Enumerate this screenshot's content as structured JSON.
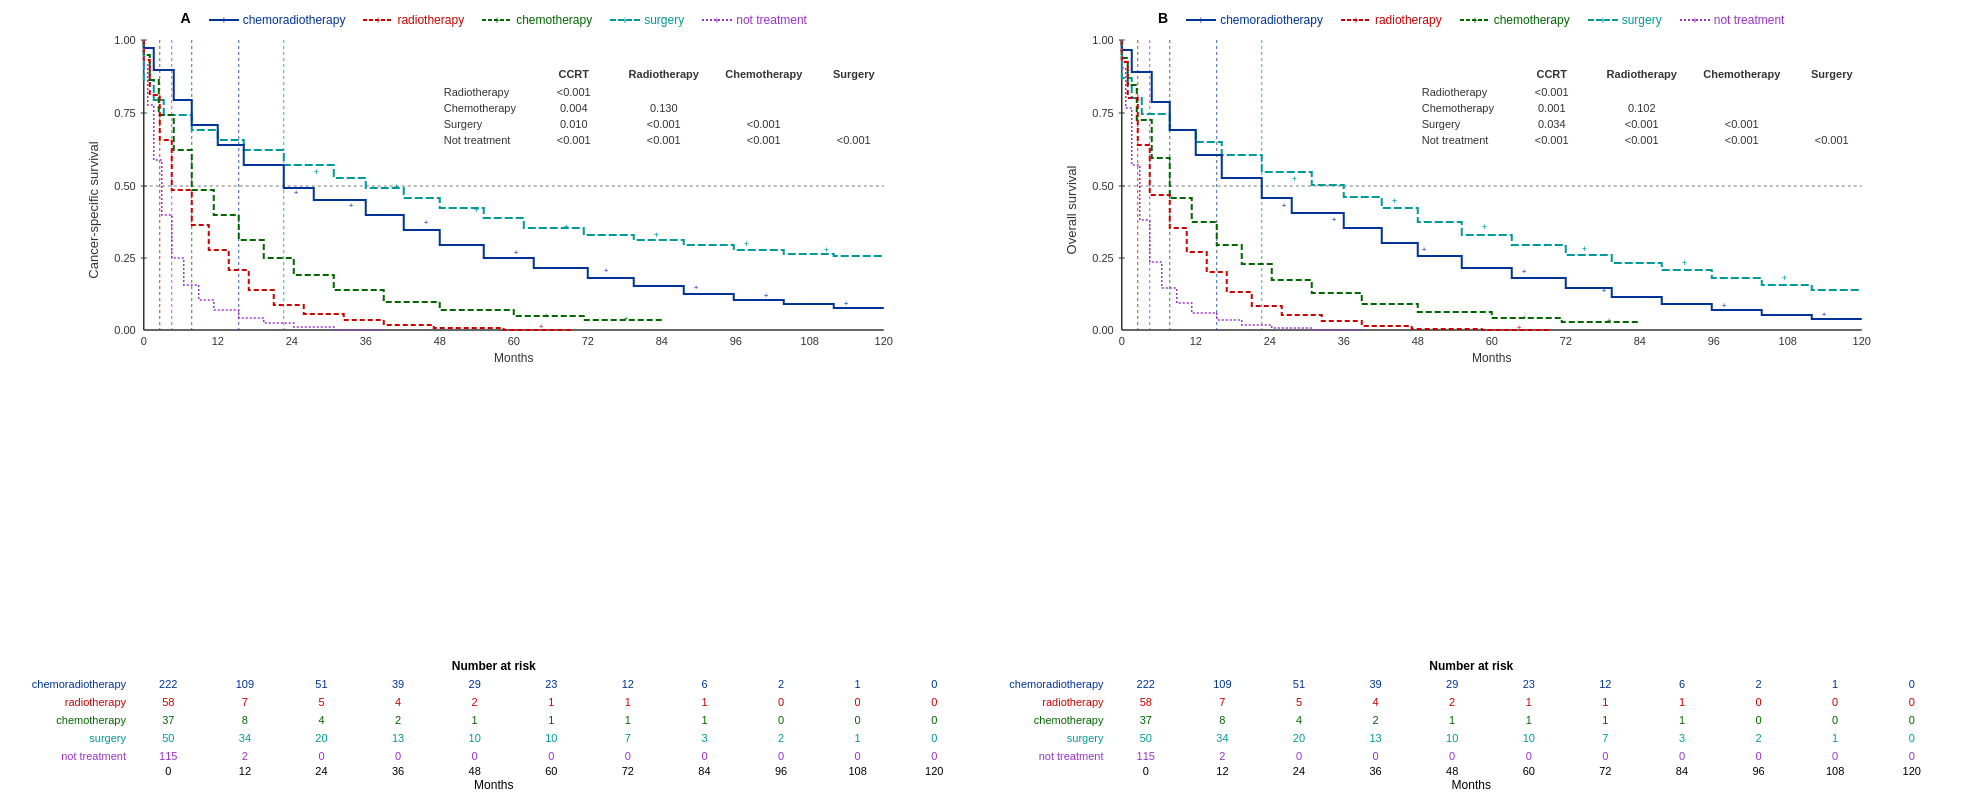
{
  "panels": [
    {
      "id": "A",
      "yLabel": "Cancer-specific survival",
      "legend": [
        {
          "label": "chemoradiotherapy",
          "color": "#003399",
          "dash": "solid",
          "marker": "+"
        },
        {
          "label": "radiotherapy",
          "color": "#cc0000",
          "dash": "dashed",
          "marker": "+"
        },
        {
          "label": "chemotherapy",
          "color": "#006600",
          "dash": "dashed",
          "marker": "+"
        },
        {
          "label": "surgery",
          "color": "#009999",
          "dash": "dashed",
          "marker": "+"
        },
        {
          "label": "not treatment",
          "color": "#9933cc",
          "dash": "dotted",
          "marker": "+"
        }
      ],
      "pvalueTable": {
        "headers": [
          "",
          "CCRT",
          "Radiotherapy",
          "Chemotherapy",
          "Surgery"
        ],
        "rows": [
          [
            "Radiotherapy",
            "<0.001",
            "",
            "",
            ""
          ],
          [
            "Chemotherapy",
            "0.004",
            "0.130",
            "",
            ""
          ],
          [
            "Surgery",
            "0.010",
            "<0.001",
            "<0.001",
            ""
          ],
          [
            "Not treatment",
            "<0.001",
            "<0.001",
            "<0.001",
            "<0.001"
          ]
        ]
      },
      "riskTable": {
        "title": "Number at risk",
        "rows": [
          {
            "label": "chemoradiotherapy",
            "color": "#003399",
            "values": [
              "222",
              "109",
              "51",
              "39",
              "29",
              "23",
              "12",
              "6",
              "2",
              "1",
              "0"
            ]
          },
          {
            "label": "radiotherapy",
            "color": "#cc0000",
            "values": [
              "58",
              "7",
              "5",
              "4",
              "2",
              "1",
              "1",
              "1",
              "0",
              "0",
              "0"
            ]
          },
          {
            "label": "chemotherapy",
            "color": "#006600",
            "values": [
              "37",
              "8",
              "4",
              "2",
              "1",
              "1",
              "1",
              "1",
              "0",
              "0",
              "0"
            ]
          },
          {
            "label": "surgery",
            "color": "#009999",
            "values": [
              "50",
              "34",
              "20",
              "13",
              "10",
              "10",
              "7",
              "3",
              "2",
              "1",
              "0"
            ]
          },
          {
            "label": "not treatment",
            "color": "#9933cc",
            "values": [
              "115",
              "2",
              "0",
              "0",
              "0",
              "0",
              "0",
              "0",
              "0",
              "0",
              "0"
            ]
          }
        ],
        "axisValues": [
          "0",
          "12",
          "24",
          "36",
          "48",
          "60",
          "72",
          "84",
          "96",
          "108",
          "120"
        ]
      }
    },
    {
      "id": "B",
      "yLabel": "Overall survival",
      "legend": [
        {
          "label": "chemoradiotherapy",
          "color": "#003399",
          "dash": "solid",
          "marker": "+"
        },
        {
          "label": "radiotherapy",
          "color": "#cc0000",
          "dash": "dashed",
          "marker": "+"
        },
        {
          "label": "chemotherapy",
          "color": "#006600",
          "dash": "dashed",
          "marker": "+"
        },
        {
          "label": "surgery",
          "color": "#009999",
          "dash": "dashed",
          "marker": "+"
        },
        {
          "label": "not treatment",
          "color": "#9933cc",
          "dash": "dotted",
          "marker": "+"
        }
      ],
      "pvalueTable": {
        "headers": [
          "",
          "CCRT",
          "Radiotherapy",
          "Chemotherapy",
          "Surgery"
        ],
        "rows": [
          [
            "Radiotherapy",
            "<0.001",
            "",
            "",
            ""
          ],
          [
            "Chemotherapy",
            "0.001",
            "0.102",
            "",
            ""
          ],
          [
            "Surgery",
            "0.034",
            "<0.001",
            "<0.001",
            ""
          ],
          [
            "Not treatment",
            "<0.001",
            "<0.001",
            "<0.001",
            "<0.001"
          ]
        ]
      },
      "riskTable": {
        "title": "Number at risk",
        "rows": [
          {
            "label": "chemoradiotherapy",
            "color": "#003399",
            "values": [
              "222",
              "109",
              "51",
              "39",
              "29",
              "23",
              "12",
              "6",
              "2",
              "1",
              "0"
            ]
          },
          {
            "label": "radiotherapy",
            "color": "#cc0000",
            "values": [
              "58",
              "7",
              "5",
              "4",
              "2",
              "1",
              "1",
              "1",
              "0",
              "0",
              "0"
            ]
          },
          {
            "label": "chemotherapy",
            "color": "#006600",
            "values": [
              "37",
              "8",
              "4",
              "2",
              "1",
              "1",
              "1",
              "1",
              "0",
              "0",
              "0"
            ]
          },
          {
            "label": "surgery",
            "color": "#009999",
            "values": [
              "50",
              "34",
              "20",
              "13",
              "10",
              "10",
              "7",
              "3",
              "2",
              "1",
              "0"
            ]
          },
          {
            "label": "not treatment",
            "color": "#9933cc",
            "values": [
              "115",
              "2",
              "0",
              "0",
              "0",
              "0",
              "0",
              "0",
              "0",
              "0",
              "0"
            ]
          }
        ],
        "axisValues": [
          "0",
          "12",
          "24",
          "36",
          "48",
          "60",
          "72",
          "84",
          "96",
          "108",
          "120"
        ]
      }
    }
  ],
  "months_label": "Months"
}
